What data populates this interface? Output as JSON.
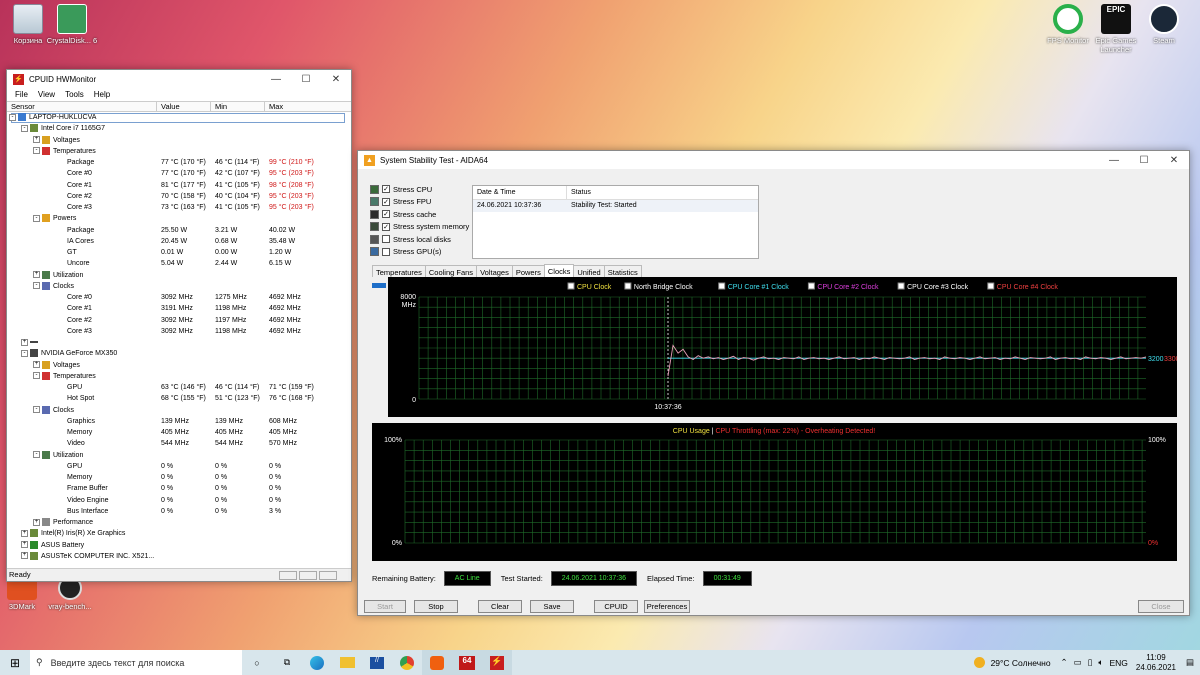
{
  "desktop": {
    "icons": [
      {
        "label": "Корзина"
      },
      {
        "label": "CrystalDisk... 6"
      },
      {
        "label": "FPS Monitor"
      },
      {
        "label": "Epic Games Launcher"
      },
      {
        "label": "Steam"
      },
      {
        "label": "3DMark"
      },
      {
        "label": "vray-bench..."
      }
    ]
  },
  "hwm": {
    "title": "CPUID HWMonitor",
    "menu": [
      "File",
      "View",
      "Tools",
      "Help"
    ],
    "columns": [
      "Sensor",
      "Value",
      "Min",
      "Max"
    ],
    "status": "Ready",
    "rows": [
      {
        "d": 0,
        "t": "LAPTOP-HUKLUCVA",
        "e": "-",
        "i": "pc"
      },
      {
        "d": 1,
        "t": "Intel Core i7 1165G7",
        "e": "-",
        "i": "chip"
      },
      {
        "d": 2,
        "t": "Voltages",
        "e": "+",
        "i": "volt"
      },
      {
        "d": 2,
        "t": "Temperatures",
        "e": "-",
        "i": "temp"
      },
      {
        "d": 3,
        "t": "Package",
        "v": "77 °C  (170 °F)",
        "mn": "46 °C  (114 °F)",
        "mx": "99 °C  (210 °F)",
        "hot": true
      },
      {
        "d": 3,
        "t": "Core #0",
        "v": "77 °C  (170 °F)",
        "mn": "42 °C  (107 °F)",
        "mx": "95 °C  (203 °F)",
        "hot": true
      },
      {
        "d": 3,
        "t": "Core #1",
        "v": "81 °C  (177 °F)",
        "mn": "41 °C  (105 °F)",
        "mx": "98 °C  (208 °F)",
        "hot": true
      },
      {
        "d": 3,
        "t": "Core #2",
        "v": "70 °C  (158 °F)",
        "mn": "40 °C  (104 °F)",
        "mx": "95 °C  (203 °F)",
        "hot": true
      },
      {
        "d": 3,
        "t": "Core #3",
        "v": "73 °C  (163 °F)",
        "mn": "41 °C  (105 °F)",
        "mx": "95 °C  (203 °F)",
        "hot": true
      },
      {
        "d": 2,
        "t": "Powers",
        "e": "-",
        "i": "power"
      },
      {
        "d": 3,
        "t": "Package",
        "v": "25.50 W",
        "mn": "3.21 W",
        "mx": "40.02 W"
      },
      {
        "d": 3,
        "t": "IA Cores",
        "v": "20.45 W",
        "mn": "0.68 W",
        "mx": "35.48 W"
      },
      {
        "d": 3,
        "t": "GT",
        "v": "0.01 W",
        "mn": "0.00 W",
        "mx": "1.20 W"
      },
      {
        "d": 3,
        "t": "Uncore",
        "v": "5.04 W",
        "mn": "2.44 W",
        "mx": "6.15 W"
      },
      {
        "d": 2,
        "t": "Utilization",
        "e": "+",
        "i": "util"
      },
      {
        "d": 2,
        "t": "Clocks",
        "e": "-",
        "i": "clock"
      },
      {
        "d": 3,
        "t": "Core #0",
        "v": "3092 MHz",
        "mn": "1275 MHz",
        "mx": "4692 MHz"
      },
      {
        "d": 3,
        "t": "Core #1",
        "v": "3191 MHz",
        "mn": "1198 MHz",
        "mx": "4692 MHz"
      },
      {
        "d": 3,
        "t": "Core #2",
        "v": "3092 MHz",
        "mn": "1197 MHz",
        "mx": "4692 MHz"
      },
      {
        "d": 3,
        "t": "Core #3",
        "v": "3092 MHz",
        "mn": "1198 MHz",
        "mx": "4692 MHz"
      },
      {
        "d": 1,
        "t": "",
        "e": "+",
        "i": "dash"
      },
      {
        "d": 1,
        "t": "NVIDIA GeForce MX350",
        "e": "-",
        "i": "gpu"
      },
      {
        "d": 2,
        "t": "Voltages",
        "e": "+",
        "i": "volt"
      },
      {
        "d": 2,
        "t": "Temperatures",
        "e": "-",
        "i": "temp"
      },
      {
        "d": 3,
        "t": "GPU",
        "v": "63 °C  (146 °F)",
        "mn": "46 °C  (114 °F)",
        "mx": "71 °C  (159 °F)"
      },
      {
        "d": 3,
        "t": "Hot Spot",
        "v": "68 °C  (155 °F)",
        "mn": "51 °C  (123 °F)",
        "mx": "76 °C  (168 °F)"
      },
      {
        "d": 2,
        "t": "Clocks",
        "e": "-",
        "i": "clock"
      },
      {
        "d": 3,
        "t": "Graphics",
        "v": "139 MHz",
        "mn": "139 MHz",
        "mx": "608 MHz"
      },
      {
        "d": 3,
        "t": "Memory",
        "v": "405 MHz",
        "mn": "405 MHz",
        "mx": "405 MHz"
      },
      {
        "d": 3,
        "t": "Video",
        "v": "544 MHz",
        "mn": "544 MHz",
        "mx": "570 MHz"
      },
      {
        "d": 2,
        "t": "Utilization",
        "e": "-",
        "i": "util"
      },
      {
        "d": 3,
        "t": "GPU",
        "v": "0 %",
        "mn": "0 %",
        "mx": "0 %"
      },
      {
        "d": 3,
        "t": "Memory",
        "v": "0 %",
        "mn": "0 %",
        "mx": "0 %"
      },
      {
        "d": 3,
        "t": "Frame Buffer",
        "v": "0 %",
        "mn": "0 %",
        "mx": "0 %"
      },
      {
        "d": 3,
        "t": "Video Engine",
        "v": "0 %",
        "mn": "0 %",
        "mx": "0 %"
      },
      {
        "d": 3,
        "t": "Bus Interface",
        "v": "0 %",
        "mn": "0 %",
        "mx": "3 %"
      },
      {
        "d": 2,
        "t": "Performance",
        "e": "+",
        "i": "perf"
      },
      {
        "d": 1,
        "t": "Intel(R) Iris(R) Xe Graphics",
        "e": "+",
        "i": "chip"
      },
      {
        "d": 1,
        "t": "ASUS Battery",
        "e": "+",
        "i": "batt"
      },
      {
        "d": 1,
        "t": "ASUSTeK COMPUTER INC. X521...",
        "e": "+",
        "i": "chip"
      }
    ]
  },
  "aida": {
    "title": "System Stability Test - AIDA64",
    "stress": [
      {
        "label": "Stress CPU",
        "checked": true
      },
      {
        "label": "Stress FPU",
        "checked": true
      },
      {
        "label": "Stress cache",
        "checked": true
      },
      {
        "label": "Stress system memory",
        "checked": true
      },
      {
        "label": "Stress local disks",
        "checked": false
      },
      {
        "label": "Stress GPU(s)",
        "checked": false
      }
    ],
    "table": {
      "headers": [
        "Date & Time",
        "Status"
      ],
      "row": [
        "24.06.2021 10:37:36",
        "Stability Test: Started"
      ]
    },
    "tabs": [
      "Temperatures",
      "Cooling Fans",
      "Voltages",
      "Powers",
      "Clocks",
      "Unified",
      "Statistics"
    ],
    "active_tab": "Clocks",
    "legend": [
      {
        "label": "CPU Clock",
        "color": "#f0e040"
      },
      {
        "label": "North Bridge Clock",
        "color": "#ffffff"
      },
      {
        "label": "CPU Core #1 Clock",
        "color": "#40e0f0"
      },
      {
        "label": "CPU Core #2 Clock",
        "color": "#e040e0"
      },
      {
        "label": "CPU Core #3 Clock",
        "color": "#ffffff"
      },
      {
        "label": "CPU Core #4 Clock",
        "color": "#f04040"
      }
    ],
    "usage_title": "CPU Usage",
    "throttle_text": "CPU Throttling (max: 22%) - Overheating Detected!",
    "remaining_battery_label": "Remaining Battery:",
    "remaining_battery": "AC Line",
    "test_started_label": "Test Started:",
    "test_started": "24.06.2021 10:37:36",
    "elapsed_label": "Elapsed Time:",
    "elapsed": "00:31:49",
    "buttons": {
      "start": "Start",
      "stop": "Stop",
      "clear": "Clear",
      "save": "Save",
      "cpuid": "CPUID",
      "prefs": "Preferences",
      "close": "Close"
    }
  },
  "chart_data": [
    {
      "type": "line",
      "title": "",
      "ylabel": "MHz",
      "ylim": [
        0,
        8000
      ],
      "y_ticks": [
        "8000",
        "0"
      ],
      "x_marker": "10:37:36",
      "right_labels": [
        "3200",
        "3300"
      ],
      "series": [
        {
          "name": "CPU Core #1 Clock",
          "values": [
            3200,
            3200,
            3200,
            3200,
            3200,
            3200,
            3200,
            3200,
            3200,
            3200,
            3200,
            3200,
            3200,
            3200,
            3200,
            3200,
            3200,
            3200,
            3200,
            3200,
            3200,
            3200,
            3200,
            3200,
            3200,
            3200,
            3200,
            3200,
            3200,
            3200,
            3200,
            3200,
            3200,
            3200,
            3200,
            3200,
            3200,
            3200,
            3200,
            3200,
            3200,
            3200,
            3200,
            3200,
            3200,
            3200,
            3200,
            3200,
            3200,
            3200,
            3200,
            3200,
            3200,
            3200,
            3200,
            3200,
            3200,
            3200,
            3200,
            3200,
            3200,
            3200,
            3200,
            3200,
            3200,
            3200,
            3200,
            3200,
            3200,
            3200,
            3200,
            3200,
            3200,
            3200,
            3200,
            3200,
            3200,
            3200,
            3200,
            3200,
            3200,
            3200,
            3200,
            3200,
            3200,
            3200,
            3200,
            3200,
            3200,
            3200,
            3200,
            3200,
            3200,
            3200,
            3200,
            3200
          ]
        },
        {
          "name": "CPU Core #4 Clock",
          "values": [
            1800,
            4200,
            3600,
            3900,
            3300,
            3100,
            3400,
            3200,
            3300,
            3150,
            3250,
            3100,
            3200,
            3350,
            3100,
            3250,
            3200,
            3050,
            3200,
            3300,
            3150,
            3200,
            3100,
            3250,
            3200,
            3150,
            3300,
            3100,
            3200,
            3250,
            3150,
            3200,
            3100,
            3200,
            3300,
            3150,
            3200,
            3250,
            3100,
            3200,
            3150,
            3300,
            3200,
            3100,
            3250,
            3200,
            3150,
            3200,
            3300,
            3100,
            3200,
            3250,
            3150,
            3200,
            3100,
            3300,
            3200,
            3150,
            3250,
            3200,
            3100,
            3200,
            3300,
            3150,
            3200,
            3250,
            3100,
            3200,
            3150,
            3300,
            3200,
            3100,
            3250,
            3200,
            3150,
            3200,
            3300,
            3100,
            3200,
            3250,
            3150,
            3200,
            3100,
            3300,
            3200,
            3150,
            3250,
            3200,
            3100,
            3200,
            3300,
            3150,
            3200,
            3250,
            3200,
            3300
          ]
        }
      ]
    },
    {
      "type": "line",
      "title": "CPU Usage",
      "ylim": [
        0,
        100
      ],
      "y_ticks": [
        "100%",
        "0%"
      ],
      "right_ticks": [
        "100%",
        "0%"
      ],
      "series": [
        {
          "name": "CPU Usage",
          "values": []
        }
      ]
    }
  ],
  "taskbar": {
    "search_placeholder": "Введите здесь текст для поиска",
    "weather": "29°C  Солнечно",
    "lang": "ENG",
    "time": "11:09",
    "date": "24.06.2021"
  }
}
